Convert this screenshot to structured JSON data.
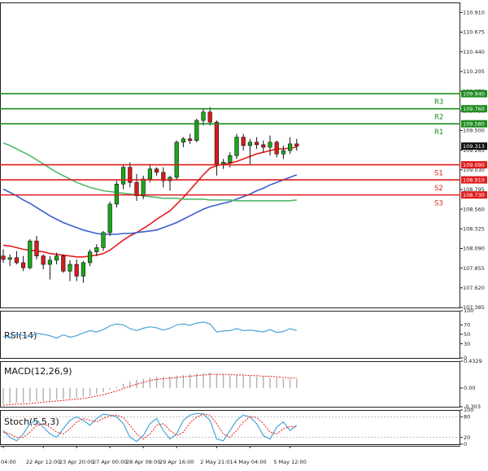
{
  "chart_data": [
    {
      "type": "candlestick",
      "panel": "main",
      "ylim": [
        107.385,
        111.03
      ],
      "y_ticks": [
        "110.910",
        "110.675",
        "110.440",
        "110.205",
        "109.970",
        "109.735",
        "109.500",
        "109.265",
        "109.030",
        "108.795",
        "108.560",
        "108.325",
        "108.090",
        "107.855",
        "107.620",
        "107.385"
      ],
      "x_labels": [
        "04:00",
        "22 Apr 12:00",
        "23 Apr 20:00",
        "27 Apr 00:00",
        "28 Apr 08:00",
        "29 Apr 16:00",
        "2 May 21:01",
        "4 May 04:00",
        "5 May 12:00"
      ],
      "x_label_index": [
        0,
        6,
        11,
        16,
        21,
        26,
        32,
        37,
        43
      ],
      "current_price": "109.313",
      "candles": [
        [
          108.0,
          108.08,
          107.92,
          107.96
        ],
        [
          107.96,
          108.02,
          107.88,
          107.98
        ],
        [
          107.98,
          108.06,
          107.9,
          107.92
        ],
        [
          107.92,
          108.0,
          107.82,
          107.86
        ],
        [
          107.86,
          108.2,
          107.84,
          108.18
        ],
        [
          108.18,
          108.24,
          107.96,
          108.0
        ],
        [
          108.0,
          108.02,
          107.84,
          107.9
        ],
        [
          107.9,
          108.0,
          107.72,
          107.95
        ],
        [
          107.95,
          108.04,
          107.9,
          108.0
        ],
        [
          108.0,
          108.02,
          107.8,
          107.82
        ],
        [
          107.82,
          107.95,
          107.7,
          107.9
        ],
        [
          107.9,
          107.96,
          107.7,
          107.76
        ],
        [
          107.76,
          107.94,
          107.68,
          107.92
        ],
        [
          107.92,
          108.08,
          107.88,
          108.05
        ],
        [
          108.05,
          108.14,
          108.0,
          108.1
        ],
        [
          108.1,
          108.3,
          108.06,
          108.28
        ],
        [
          108.28,
          108.65,
          108.24,
          108.62
        ],
        [
          108.62,
          108.9,
          108.58,
          108.86
        ],
        [
          108.86,
          109.1,
          108.8,
          109.06
        ],
        [
          109.06,
          109.12,
          108.82,
          108.88
        ],
        [
          108.88,
          108.98,
          108.66,
          108.72
        ],
        [
          108.72,
          108.96,
          108.68,
          108.92
        ],
        [
          108.92,
          109.1,
          108.88,
          109.04
        ],
        [
          109.04,
          109.06,
          108.96,
          109.0
        ],
        [
          109.0,
          109.06,
          108.82,
          108.9
        ],
        [
          108.9,
          108.96,
          108.78,
          108.94
        ],
        [
          108.94,
          109.38,
          108.9,
          109.36
        ],
        [
          109.36,
          109.42,
          109.3,
          109.4
        ],
        [
          109.4,
          109.46,
          109.34,
          109.38
        ],
        [
          109.38,
          109.64,
          109.36,
          109.62
        ],
        [
          109.62,
          109.76,
          109.56,
          109.72
        ],
        [
          109.72,
          109.78,
          109.56,
          109.6
        ],
        [
          109.6,
          109.62,
          108.96,
          109.1
        ],
        [
          109.1,
          109.16,
          109.04,
          109.12
        ],
        [
          109.12,
          109.24,
          109.06,
          109.2
        ],
        [
          109.2,
          109.46,
          109.16,
          109.42
        ],
        [
          109.42,
          109.46,
          109.26,
          109.32
        ],
        [
          109.32,
          109.4,
          109.1,
          109.36
        ],
        [
          109.36,
          109.42,
          109.28,
          109.33
        ],
        [
          109.33,
          109.38,
          109.24,
          109.3
        ],
        [
          109.3,
          109.44,
          109.2,
          109.36
        ],
        [
          109.36,
          109.38,
          109.18,
          109.22
        ],
        [
          109.22,
          109.32,
          109.16,
          109.26
        ],
        [
          109.26,
          109.42,
          109.22,
          109.34
        ],
        [
          109.34,
          109.4,
          109.26,
          109.313
        ]
      ],
      "series": [
        {
          "color": "#e81c1c",
          "values": [
            108.13,
            108.12,
            108.1,
            108.08,
            108.07,
            108.06,
            108.05,
            108.03,
            108.02,
            108.01,
            108.0,
            107.99,
            107.99,
            108.0,
            108.01,
            108.03,
            108.07,
            108.13,
            108.19,
            108.24,
            108.28,
            108.33,
            108.38,
            108.44,
            108.49,
            108.54,
            108.62,
            108.7,
            108.79,
            108.88,
            108.97,
            109.05,
            109.08,
            109.1,
            109.11,
            109.13,
            109.16,
            109.19,
            109.22,
            109.24,
            109.26,
            109.28,
            109.28,
            109.29,
            109.3
          ]
        },
        {
          "color": "#3a5fcd",
          "values": [
            108.8,
            108.76,
            108.72,
            108.67,
            108.63,
            108.58,
            108.53,
            108.48,
            108.44,
            108.4,
            108.37,
            108.34,
            108.31,
            108.29,
            108.27,
            108.26,
            108.26,
            108.26,
            108.27,
            108.27,
            108.28,
            108.29,
            108.3,
            108.31,
            108.34,
            108.37,
            108.4,
            108.44,
            108.48,
            108.52,
            108.56,
            108.59,
            108.61,
            108.63,
            108.65,
            108.68,
            108.71,
            108.74,
            108.78,
            108.81,
            108.85,
            108.88,
            108.91,
            108.94,
            108.97
          ]
        },
        {
          "color": "#52b86b",
          "values": [
            109.35,
            109.32,
            109.28,
            109.24,
            109.2,
            109.15,
            109.1,
            109.05,
            109.0,
            108.96,
            108.92,
            108.88,
            108.85,
            108.82,
            108.8,
            108.78,
            108.77,
            108.76,
            108.75,
            108.74,
            108.73,
            108.72,
            108.71,
            108.7,
            108.69,
            108.69,
            108.69,
            108.68,
            108.68,
            108.68,
            108.68,
            108.67,
            108.67,
            108.67,
            108.67,
            108.66,
            108.66,
            108.66,
            108.66,
            108.66,
            108.66,
            108.66,
            108.66,
            108.66,
            108.67
          ]
        }
      ],
      "levels": [
        {
          "label": "R3",
          "value": "109.940",
          "color": "#1e8c1e"
        },
        {
          "label": "R2",
          "value": "109.760",
          "color": "#1e8c1e"
        },
        {
          "label": "R1",
          "value": "109.580",
          "color": "#1e8c1e"
        },
        {
          "label": "S1",
          "value": "109.090",
          "color": "#e01c1c"
        },
        {
          "label": "S2",
          "value": "108.910",
          "color": "#e01c1c"
        },
        {
          "label": "S3",
          "value": "108.730",
          "color": "#e01c1c"
        }
      ]
    },
    {
      "type": "line",
      "panel": "rsi",
      "title": "RSI(14)",
      "ylim": [
        0,
        100
      ],
      "y_ticks": [
        "100",
        "70",
        "50",
        "30",
        "0"
      ],
      "color": "#4aa3d6",
      "values": [
        46,
        44,
        50,
        48,
        45,
        52,
        50,
        47,
        42,
        49,
        44,
        47,
        53,
        58,
        55,
        60,
        68,
        72,
        70,
        62,
        58,
        63,
        66,
        64,
        59,
        63,
        70,
        72,
        69,
        74,
        76,
        72,
        55,
        57,
        58,
        62,
        58,
        59,
        57,
        55,
        60,
        54,
        56,
        62,
        58
      ]
    },
    {
      "type": "bar",
      "panel": "macd",
      "title": "MACD(12,26,9)",
      "ylim": [
        -0.303,
        0.4329
      ],
      "y_ticks": [
        "0.4329",
        "0.00",
        "-0.303"
      ],
      "bar_color": "#b0b0b0",
      "signal_color": "#e01c1c",
      "values": [
        -0.26,
        -0.25,
        -0.24,
        -0.24,
        -0.22,
        -0.21,
        -0.21,
        -0.2,
        -0.19,
        -0.18,
        -0.17,
        -0.16,
        -0.14,
        -0.12,
        -0.1,
        -0.07,
        -0.03,
        0.02,
        0.07,
        0.11,
        0.13,
        0.15,
        0.17,
        0.18,
        0.18,
        0.18,
        0.2,
        0.21,
        0.22,
        0.23,
        0.24,
        0.25,
        0.23,
        0.22,
        0.21,
        0.21,
        0.2,
        0.19,
        0.18,
        0.18,
        0.17,
        0.16,
        0.15,
        0.14,
        0.14
      ],
      "signal": [
        -0.28,
        -0.27,
        -0.26,
        -0.26,
        -0.25,
        -0.24,
        -0.23,
        -0.22,
        -0.21,
        -0.2,
        -0.19,
        -0.18,
        -0.17,
        -0.15,
        -0.13,
        -0.11,
        -0.08,
        -0.05,
        -0.01,
        0.03,
        0.06,
        0.09,
        0.12,
        0.14,
        0.15,
        0.16,
        0.17,
        0.18,
        0.19,
        0.2,
        0.21,
        0.22,
        0.22,
        0.22,
        0.22,
        0.21,
        0.21,
        0.2,
        0.2,
        0.19,
        0.19,
        0.18,
        0.17,
        0.16,
        0.16
      ]
    },
    {
      "type": "line",
      "panel": "stoch",
      "title": "Stoch(5,5,3)",
      "ylim": [
        0,
        100
      ],
      "y_ticks": [
        "100",
        "80",
        "20",
        "0"
      ],
      "main_color": "#4aa3d6",
      "signal_color": "#e01c1c",
      "values": [
        40,
        20,
        10,
        30,
        60,
        70,
        50,
        30,
        20,
        45,
        70,
        80,
        70,
        55,
        75,
        88,
        85,
        80,
        60,
        20,
        8,
        25,
        60,
        75,
        40,
        15,
        30,
        70,
        85,
        90,
        88,
        70,
        15,
        10,
        40,
        70,
        85,
        80,
        60,
        25,
        15,
        50,
        65,
        40,
        55
      ],
      "signal": [
        35,
        30,
        20,
        20,
        35,
        55,
        60,
        50,
        35,
        30,
        45,
        65,
        75,
        70,
        65,
        75,
        83,
        85,
        78,
        55,
        30,
        15,
        30,
        55,
        60,
        40,
        25,
        35,
        62,
        80,
        88,
        85,
        60,
        30,
        20,
        40,
        65,
        80,
        78,
        60,
        35,
        30,
        45,
        52,
        50
      ]
    }
  ]
}
